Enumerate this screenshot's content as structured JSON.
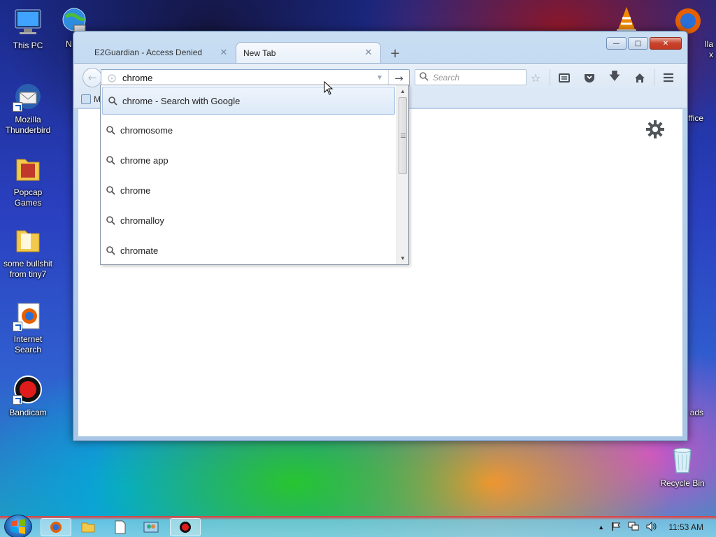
{
  "desktop": {
    "icons_left": [
      {
        "label": "This PC",
        "icon": "computer-icon"
      },
      {
        "label": "Mozilla Thunderbird",
        "icon": "thunderbird-icon"
      },
      {
        "label": "Popcap Games",
        "icon": "folder-icon"
      },
      {
        "label": "some bullshit from tiny7",
        "icon": "folder-icon"
      },
      {
        "label": "Internet Search",
        "icon": "firefox-icon"
      },
      {
        "label": "Bandicam",
        "icon": "bandicam-icon"
      }
    ],
    "partial_labels": {
      "network": "N",
      "firefox_right": "lla",
      "firefox_right2": "x",
      "office_right": "ffice",
      "downloads_right": "ads"
    },
    "recycle_bin": "Recycle Bin"
  },
  "browser": {
    "tabs": [
      {
        "title": "E2Guardian - Access Denied",
        "active": false
      },
      {
        "title": "New Tab",
        "active": true
      }
    ],
    "new_tab_symbol": "+",
    "url_value": "chrome",
    "search_placeholder": "Search",
    "bookmark_partial": "M",
    "toolbar_icons": [
      "star-icon",
      "reading-list-icon",
      "pocket-icon",
      "download-icon",
      "home-icon",
      "menu-icon"
    ]
  },
  "autocomplete": {
    "items": [
      {
        "text": "chrome - Search with Google",
        "selected": true
      },
      {
        "text": "chromosome"
      },
      {
        "text": "chrome app"
      },
      {
        "text": "chrome"
      },
      {
        "text": "chromalloy"
      },
      {
        "text": "chromate"
      }
    ]
  },
  "taskbar": {
    "clock": "11:53 AM",
    "accent": "#d43a3a"
  }
}
